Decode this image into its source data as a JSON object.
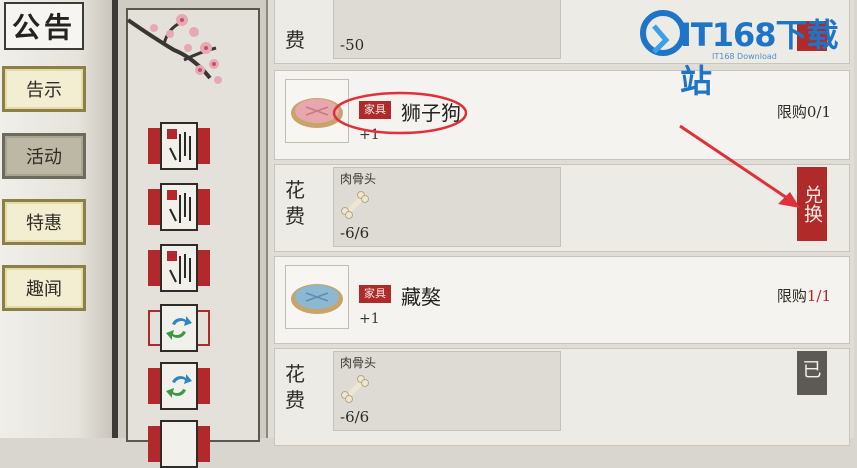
{
  "nav": {
    "title": "公告",
    "items": [
      {
        "label": "告示"
      },
      {
        "label": "活动",
        "active": true
      },
      {
        "label": "特惠"
      },
      {
        "label": "趣闻"
      }
    ]
  },
  "list": {
    "top_cost": {
      "label": "费",
      "count": "-50"
    },
    "items": [
      {
        "tag": "家具",
        "name": "狮子狗",
        "quantity": "+1",
        "limit_label": "限购",
        "limit_used": "0/1",
        "cost_label": "花费",
        "cost_item": "肉骨头",
        "cost_count": "-6/6",
        "button": "兑换"
      },
      {
        "tag": "家具",
        "name": "藏獒",
        "quantity": "+1",
        "limit_label": "限购",
        "limit_used": "1/1",
        "cost_label": "花费",
        "cost_item": "肉骨头",
        "cost_count": "-6/6",
        "button": "已"
      }
    ]
  },
  "watermark": {
    "text": "IT168下载站",
    "subtext": "IT168 Download"
  },
  "colors": {
    "accent_red": "#b02a2a",
    "annotation_red": "#e0303a",
    "watermark_blue": "#1e74c6"
  }
}
